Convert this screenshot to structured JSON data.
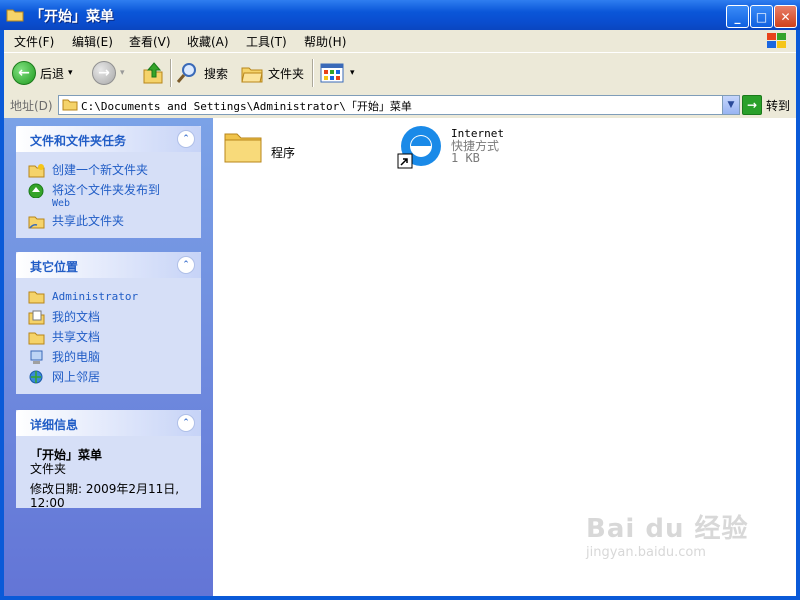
{
  "window": {
    "title": "「开始」菜单",
    "buttons": {
      "minimize": "_",
      "maximize": "□",
      "close": "✕"
    }
  },
  "menubar": {
    "items": [
      {
        "label": "文件(F)"
      },
      {
        "label": "编辑(E)"
      },
      {
        "label": "查看(V)"
      },
      {
        "label": "收藏(A)"
      },
      {
        "label": "工具(T)"
      },
      {
        "label": "帮助(H)"
      }
    ]
  },
  "toolbar": {
    "back_label": "后退",
    "search_label": "搜索",
    "folders_label": "文件夹",
    "back_glyph": "←",
    "forward_glyph": "→",
    "dropdown_glyph": "▾"
  },
  "addressbar": {
    "label": "地址(D)",
    "path": "C:\\Documents and Settings\\Administrator\\「开始」菜单",
    "go_label": "转到",
    "go_glyph": "→",
    "drop_glyph": "▼"
  },
  "sidebar": {
    "tasks": {
      "title": "文件和文件夹任务",
      "items": [
        {
          "label": "创建一个新文件夹",
          "icon": "new-folder-icon"
        },
        {
          "label": "将这个文件夹发布到",
          "sub": "Web",
          "icon": "publish-web-icon"
        },
        {
          "label": "共享此文件夹",
          "icon": "share-folder-icon"
        }
      ]
    },
    "places": {
      "title": "其它位置",
      "items": [
        {
          "label": "Administrator",
          "icon": "folder-icon"
        },
        {
          "label": "我的文档",
          "icon": "my-documents-icon"
        },
        {
          "label": "共享文档",
          "icon": "shared-documents-icon"
        },
        {
          "label": "我的电脑",
          "icon": "my-computer-icon"
        },
        {
          "label": "网上邻居",
          "icon": "network-places-icon"
        }
      ]
    },
    "details": {
      "title": "详细信息",
      "name": "「开始」菜单",
      "type": "文件夹",
      "modified": "修改日期: 2009年2月11日,",
      "time": "12:00"
    },
    "collapse_glyph": "⌃"
  },
  "content": {
    "files": [
      {
        "name": "程序",
        "icon": "folder-icon"
      },
      {
        "name": "Internet",
        "type": "快捷方式",
        "size": "1 KB",
        "icon": "ie-shortcut-icon"
      }
    ]
  },
  "watermark": {
    "line1": "Bai du 经验",
    "line2": "jingyan.baidu.com"
  },
  "colors": {
    "titlebar": "#0a56d8",
    "sidebar": "#6375d6",
    "panel_title": "#215dc6",
    "chrome": "#ece9d8"
  }
}
